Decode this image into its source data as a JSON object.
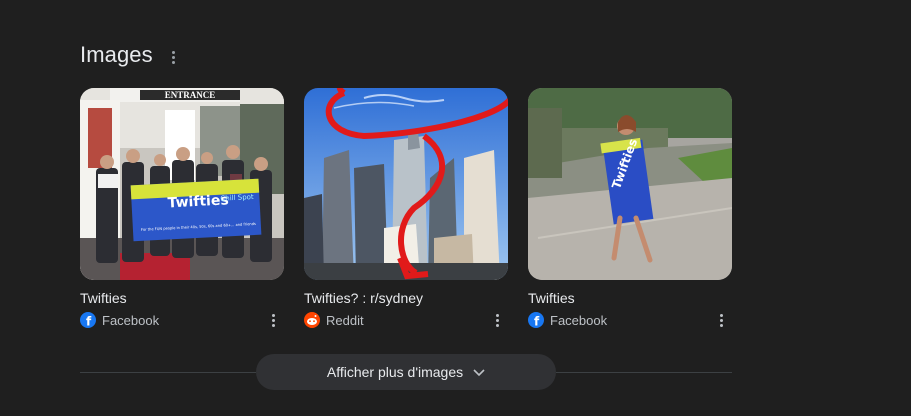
{
  "section": {
    "title": "Images"
  },
  "results": [
    {
      "title": "Twifties",
      "source": "Facebook",
      "source_icon": "facebook-icon"
    },
    {
      "title": "Twifties? : r/sydney",
      "source": "Reddit",
      "source_icon": "reddit-icon"
    },
    {
      "title": "Twifties",
      "source": "Facebook",
      "source_icon": "facebook-icon"
    }
  ],
  "banner": {
    "main": "Twifties",
    "sub": "Chill Spot",
    "caption": "For the FUN people in their 40s, 50s, 60s and 60+... and friends",
    "sign": "ENTRANCE"
  },
  "show_more": {
    "label": "Afficher plus d'images",
    "icon": "chevron-down-icon"
  },
  "colors": {
    "background": "#1f1f1f",
    "button": "#303134",
    "facebook": "#1877f2",
    "reddit": "#ff4500",
    "annotation_red": "#e11a1a"
  }
}
